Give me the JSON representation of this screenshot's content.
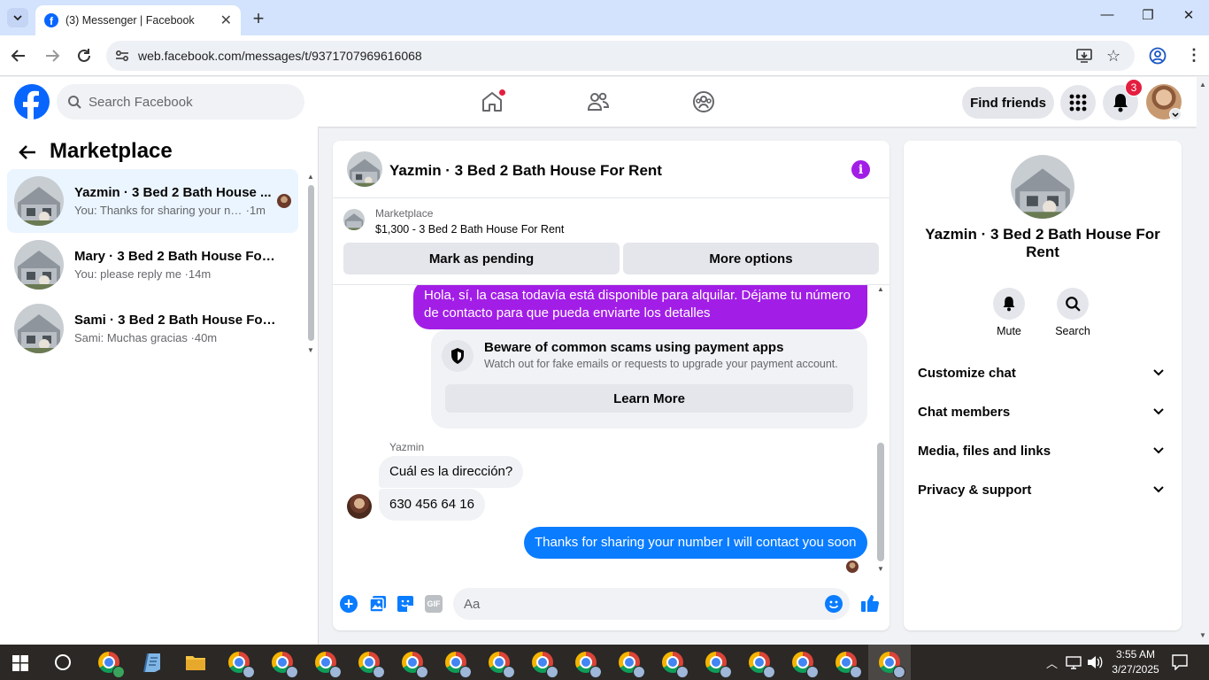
{
  "browser": {
    "tab_title": "(3) Messenger | Facebook",
    "url": "web.facebook.com/messages/t/9371707969616068"
  },
  "fb": {
    "search_placeholder": "Search Facebook",
    "find_friends": "Find friends",
    "notification_count": "3"
  },
  "left": {
    "title": "Marketplace",
    "conversations": [
      {
        "title": "Yazmin · 3 Bed 2 Bath House ...",
        "preview": "You: Thanks for sharing your nu...",
        "time": "1m"
      },
      {
        "title": "Mary · 3 Bed 2 Bath House For R...",
        "preview": "You: please reply me",
        "time": "14m"
      },
      {
        "title": "Sami · 3 Bed 2 Bath House For R...",
        "preview": "Sami: Muchas gracias",
        "time": "40m"
      }
    ]
  },
  "chat": {
    "header_title": "Yazmin · 3 Bed 2 Bath House For Rent",
    "listing_label": "Marketplace",
    "listing_text": "$1,300 - 3 Bed 2 Bath House For Rent",
    "mark_pending": "Mark as pending",
    "more_options": "More options",
    "msg_out_1": "Hola, sí, la casa todavía está disponible para alquilar. Déjame tu número de contacto para que pueda enviarte los detalles",
    "warning_title": "Beware of common scams using payment apps",
    "warning_text": "Watch out for fake emails or requests to upgrade your payment account.",
    "learn_more": "Learn More",
    "sender_name": "Yazmin",
    "msg_in_1": "Cuál es la dirección?",
    "msg_in_2": "630 456 64 16",
    "msg_out_2": "Thanks for sharing your number I will contact you soon",
    "composer_placeholder": "Aa"
  },
  "right": {
    "name": "Yazmin · 3 Bed 2 Bath House For Rent",
    "mute": "Mute",
    "search": "Search",
    "sections": [
      "Customize chat",
      "Chat members",
      "Media, files and links",
      "Privacy & support"
    ]
  },
  "taskbar": {
    "time": "3:55 AM",
    "date": "3/27/2025"
  },
  "colors": {
    "fb_blue": "#0866ff",
    "messenger_purple": "#a21ee6",
    "messenger_blue": "#0a7cff"
  }
}
